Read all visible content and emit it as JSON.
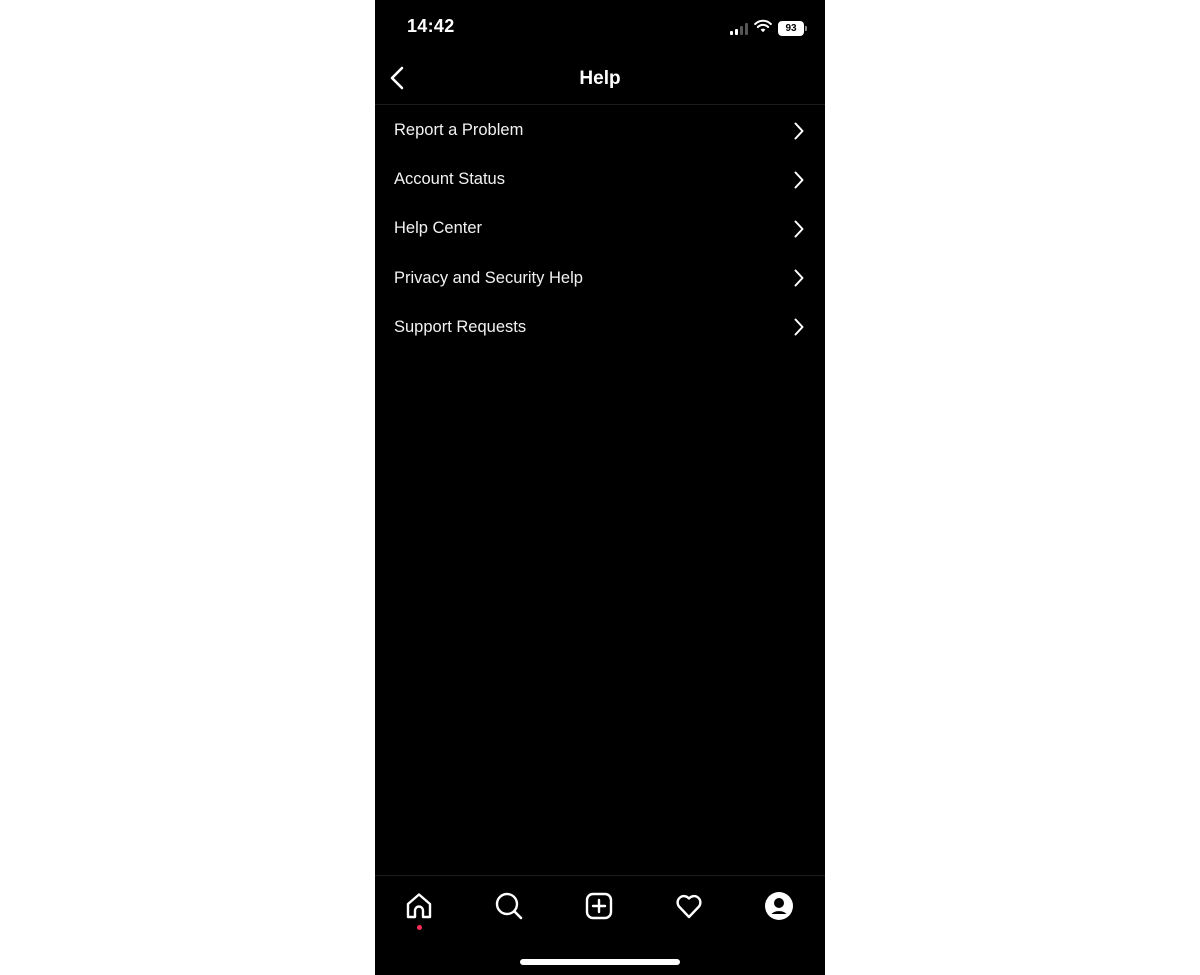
{
  "status_bar": {
    "time": "14:42",
    "battery_level": "93",
    "signal_bars_active": 2,
    "signal_bars_total": 4,
    "icons": [
      "signal-icon",
      "wifi-icon",
      "battery-icon"
    ]
  },
  "header": {
    "title": "Help",
    "back_icon": "chevron-left-icon"
  },
  "menu": {
    "items": [
      {
        "label": "Report a Problem",
        "icon": "chevron-right-icon"
      },
      {
        "label": "Account Status",
        "icon": "chevron-right-icon"
      },
      {
        "label": "Help Center",
        "icon": "chevron-right-icon"
      },
      {
        "label": "Privacy and Security Help",
        "icon": "chevron-right-icon"
      },
      {
        "label": "Support Requests",
        "icon": "chevron-right-icon"
      }
    ]
  },
  "tab_bar": {
    "tabs": [
      {
        "name": "home",
        "icon": "home-icon",
        "has_notification_dot": true
      },
      {
        "name": "search",
        "icon": "search-icon"
      },
      {
        "name": "create",
        "icon": "plus-square-icon"
      },
      {
        "name": "activity",
        "icon": "heart-icon"
      },
      {
        "name": "profile",
        "icon": "profile-avatar-icon"
      }
    ],
    "notification_dot_color": "#ff2d55"
  },
  "colors": {
    "background": "#000000",
    "text": "#ffffff",
    "divider": "#1c1c1c"
  }
}
